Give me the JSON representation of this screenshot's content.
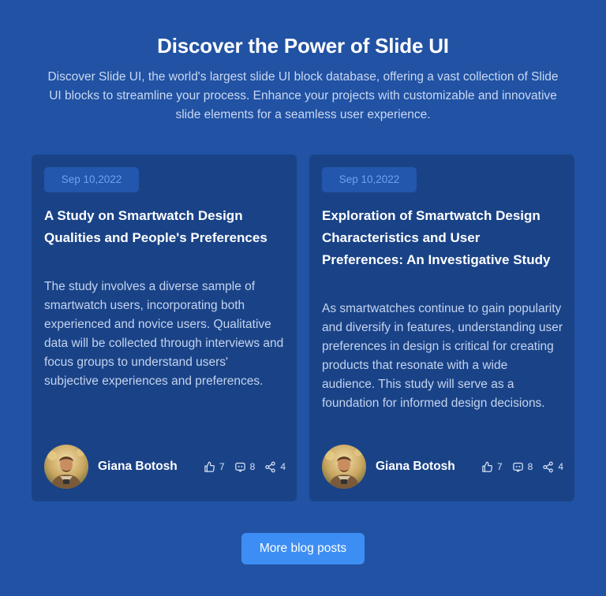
{
  "header": {
    "title": "Discover the Power of Slide UI",
    "subtitle": "Discover Slide UI, the world's largest slide UI block database, offering a vast collection of Slide UI blocks to streamline your process. Enhance your projects with customizable and innovative slide elements for a seamless user experience."
  },
  "posts": [
    {
      "date": "Sep 10,2022",
      "title": "A Study on Smartwatch Design Qualities and People's Preferences",
      "body": "The study involves a diverse sample of smartwatch users, incorporating both experienced and novice users. Qualitative data will be collected through interviews and focus groups to understand users' subjective experiences and preferences.",
      "author": "Giana Botosh",
      "likes": "7",
      "comments": "8",
      "shares": "4"
    },
    {
      "date": "Sep 10,2022",
      "title": "Exploration of Smartwatch Design Characteristics and User Preferences: An Investigative Study",
      "body": "As smartwatches continue to gain popularity and diversify in features, understanding user preferences in design is critical for creating products that resonate with a wide audience. This study will serve as a foundation for informed design decisions.",
      "author": "Giana Botosh",
      "likes": "7",
      "comments": "8",
      "shares": "4"
    }
  ],
  "footer": {
    "more_label": "More blog posts"
  },
  "icons": {
    "like": "thumbs-up-icon",
    "comment": "comment-icon",
    "share": "share-icon"
  },
  "colors": {
    "background": "#2152a3",
    "card": "#1a4387",
    "date_badge": "#2356ad",
    "date_text": "#6ea2ef",
    "accent_button": "#3d8ef4"
  }
}
